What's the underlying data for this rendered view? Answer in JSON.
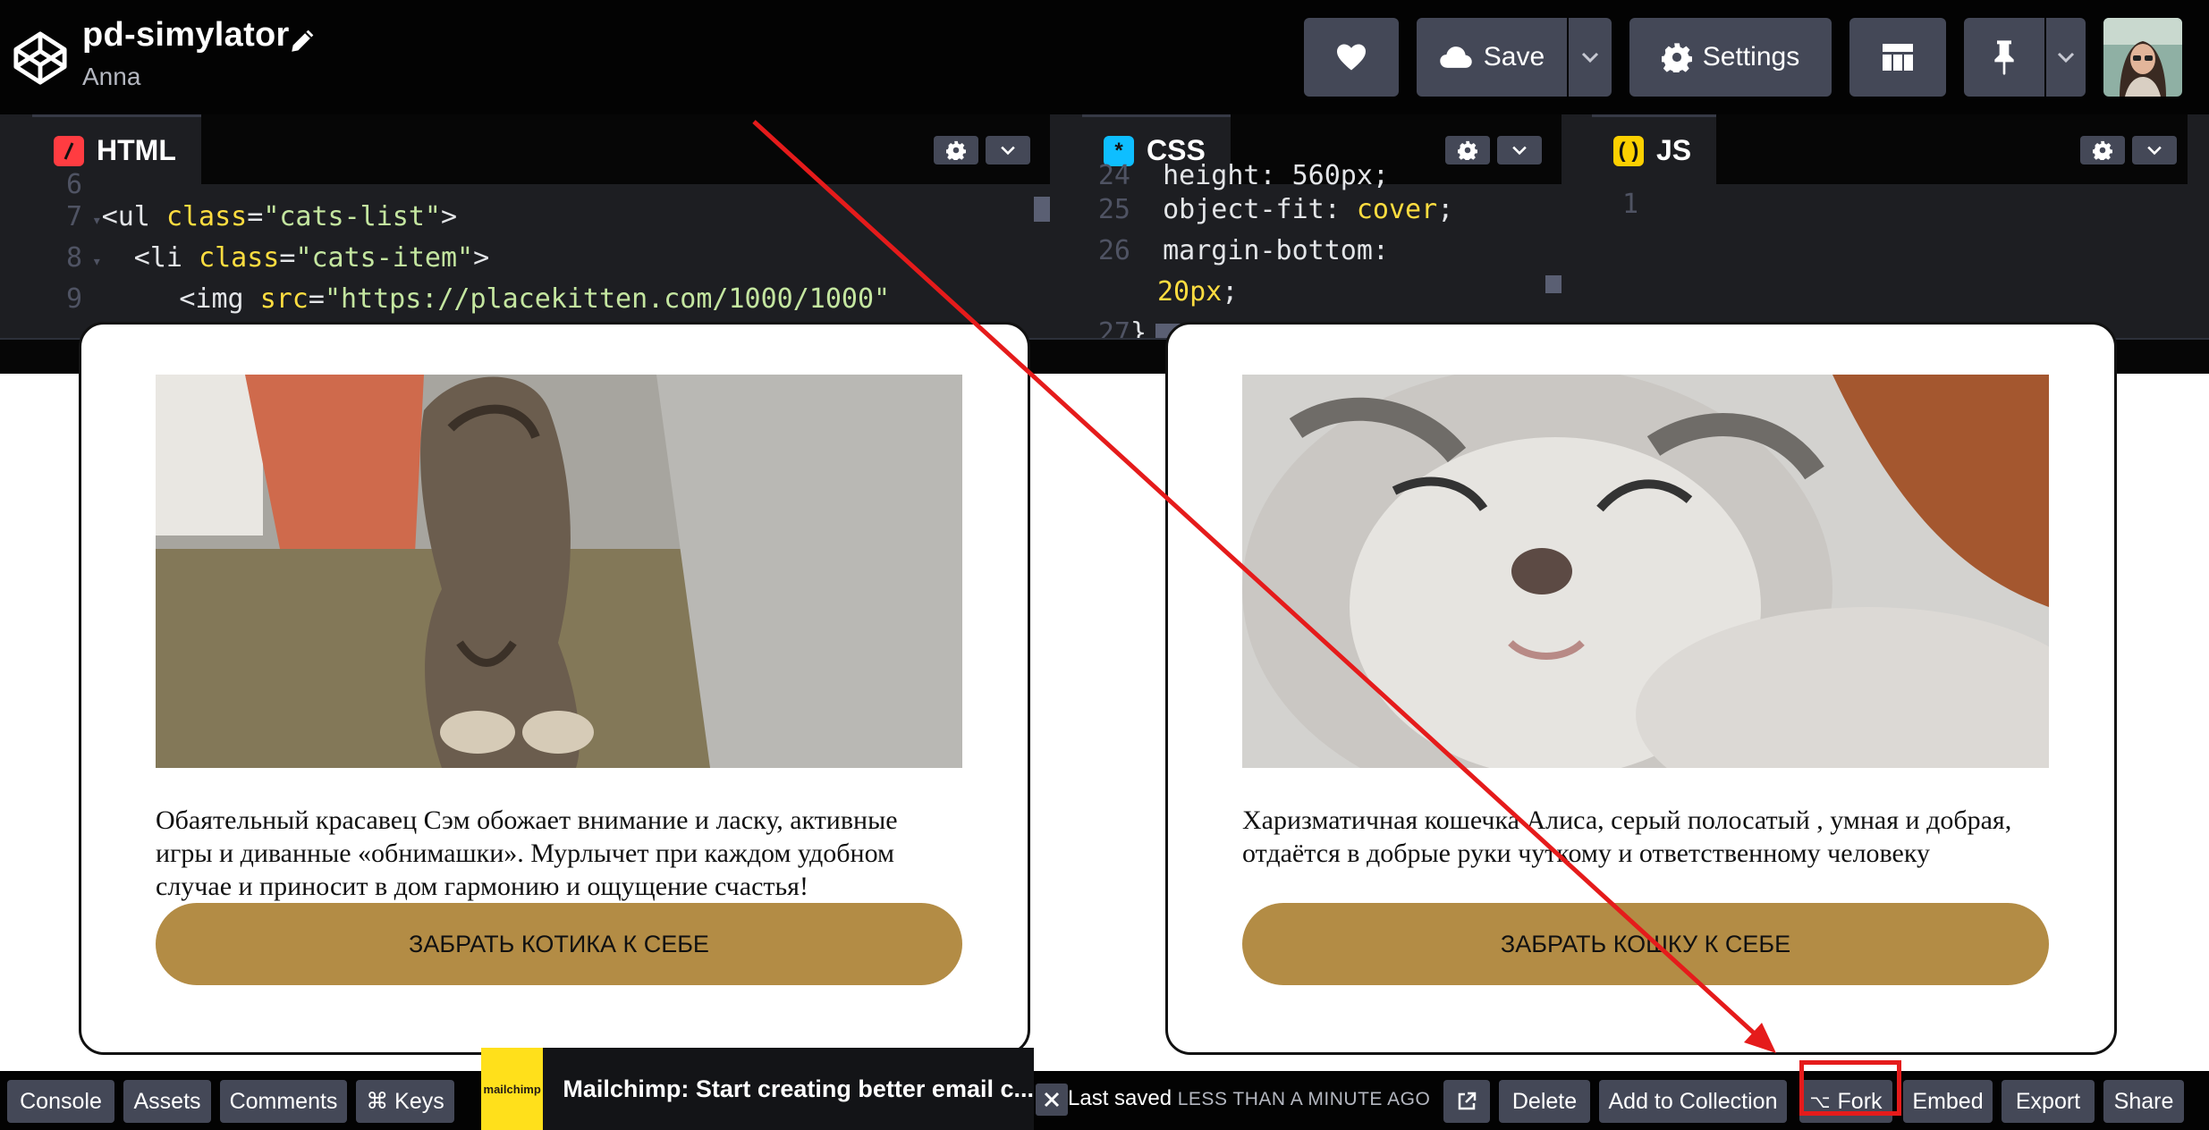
{
  "header": {
    "pen_title": "pd-simylator",
    "owner": "Anna",
    "save_label": "Save",
    "settings_label": "Settings"
  },
  "editors": {
    "html": {
      "label": "HTML",
      "lines": [
        {
          "num": "6",
          "text": ""
        },
        {
          "num": "7",
          "text": "<ul class=\"cats-list\">"
        },
        {
          "num": "8",
          "text": "  <li class=\"cats-item\">"
        },
        {
          "num": "9",
          "text": "    <img src=\"https://placekitten.com/1000/1000\""
        }
      ]
    },
    "css": {
      "label": "CSS",
      "lines": [
        {
          "num": "24",
          "text": "  height: 560px;"
        },
        {
          "num": "25",
          "text": "  object-fit: cover;"
        },
        {
          "num": "26",
          "text": "  margin-bottom:"
        },
        {
          "num": "",
          "text": "20px;"
        },
        {
          "num": "27",
          "text": "}"
        }
      ]
    },
    "js": {
      "label": "JS",
      "lines": [
        {
          "num": "1",
          "text": ""
        }
      ]
    }
  },
  "preview": {
    "cards": [
      {
        "description": "Обаятельный красавец Сэм обожает внимание и ласку, активные игры и диванные «обнимашки». Мурлычет при каждом удобном случае и приносит в дом гармонию и ощущение счастья!",
        "button": "ЗАБРАТЬ КОТИКА К СЕБЕ"
      },
      {
        "description": "Харизматичная кошечка Алиса, серый полосатый , умная и добрая, отдаётся в добрые руки чуткому и ответственному человеку",
        "button": "ЗАБРАТЬ КОШКУ К СЕБЕ"
      }
    ]
  },
  "footer": {
    "left_buttons": [
      "Console",
      "Assets",
      "Comments",
      "⌘ Keys"
    ],
    "ad_logo": "mailchimp",
    "ad_text": "Mailchimp: Start creating better email c...",
    "saved_prefix": "Last saved",
    "saved_time": "LESS THAN A MINUTE AGO",
    "right_buttons": [
      "Delete",
      "Add to Collection",
      "Fork",
      "Embed",
      "Export",
      "Share"
    ]
  },
  "colors": {
    "accent_button": "#b38c45",
    "annotation": "#e51b1b",
    "header_bg": "#030303",
    "button_bg": "#444857"
  }
}
